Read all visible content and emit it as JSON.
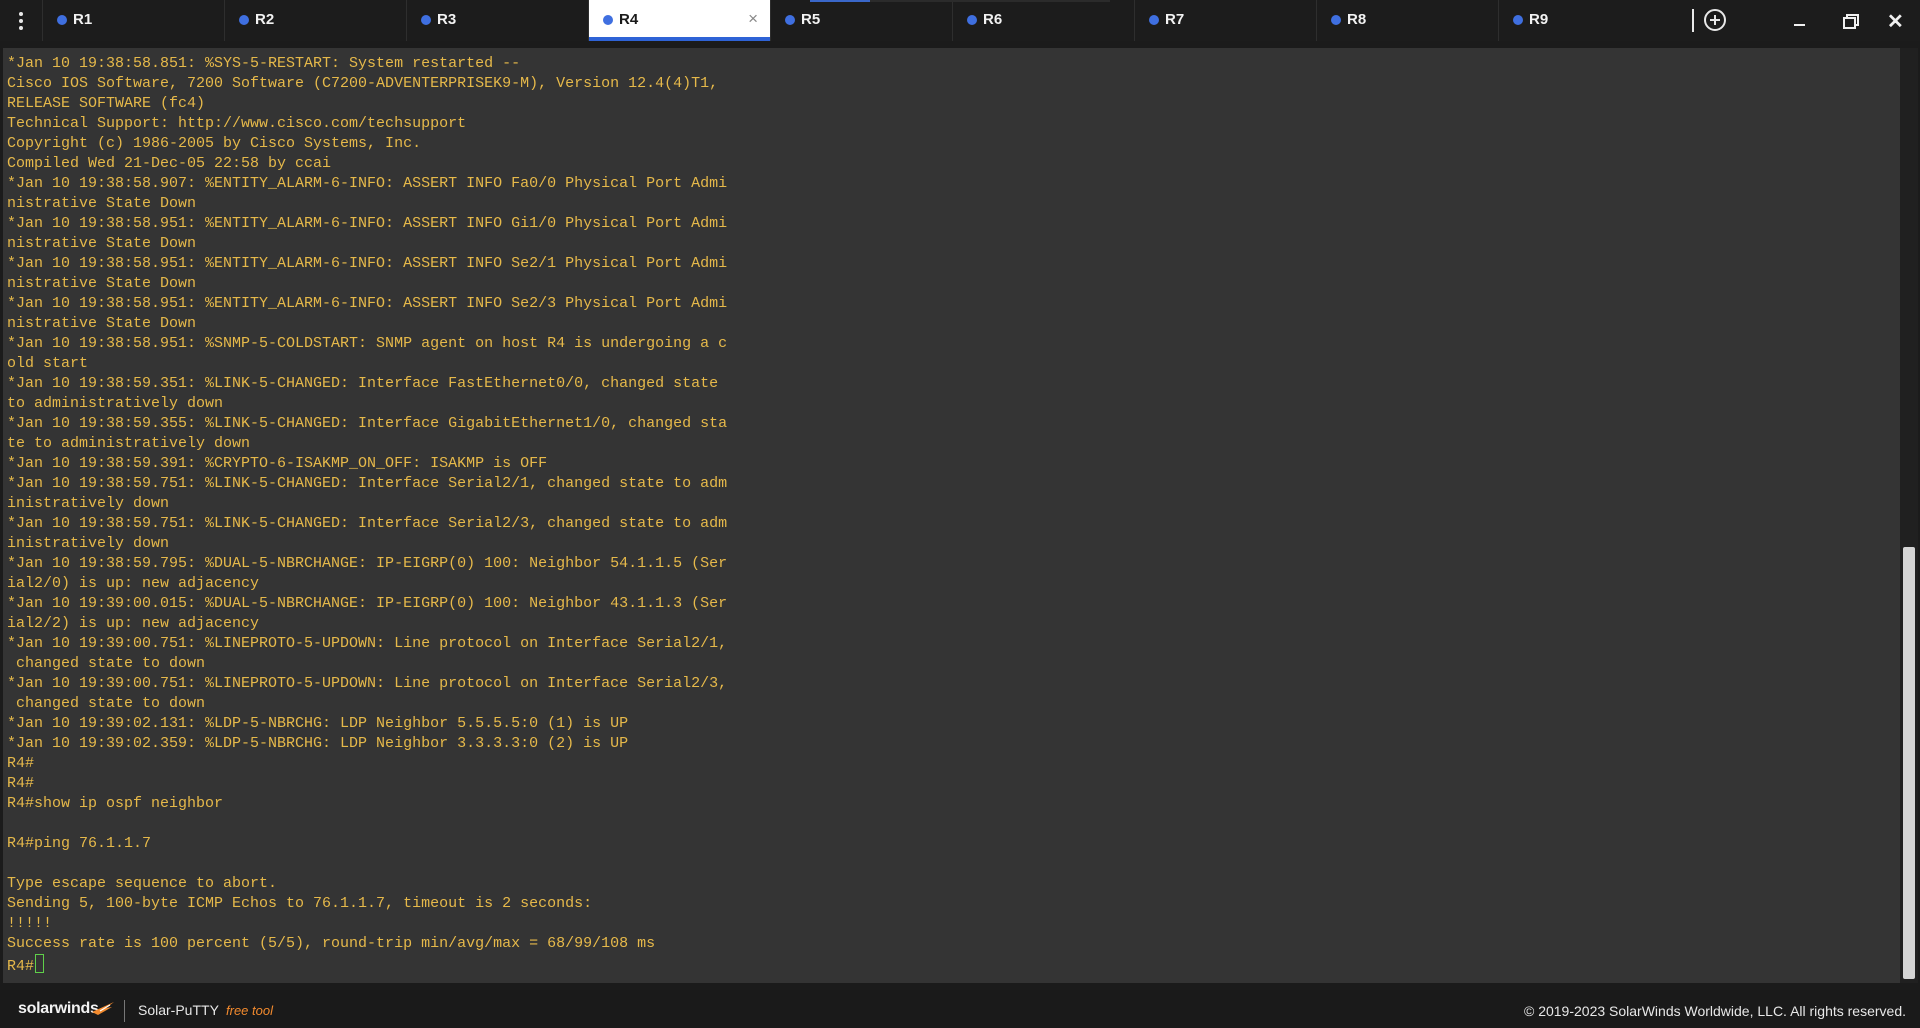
{
  "app": {
    "name": "Solar-PuTTY",
    "vendor": "solarwinds"
  },
  "tabs": [
    {
      "label": "R1",
      "active": false
    },
    {
      "label": "R2",
      "active": false
    },
    {
      "label": "R3",
      "active": false
    },
    {
      "label": "R4",
      "active": true
    },
    {
      "label": "R5",
      "active": false
    },
    {
      "label": "R6",
      "active": false
    },
    {
      "label": "R7",
      "active": false
    },
    {
      "label": "R8",
      "active": false
    },
    {
      "label": "R9",
      "active": false
    }
  ],
  "window_controls": {
    "add_tab": "add-tab",
    "minimize": "minimize",
    "restore": "restore",
    "close": "close"
  },
  "close_tab_glyph": "×",
  "colors": {
    "terminal_bg": "#343434",
    "terminal_text": "#e6b94a",
    "active_tab_accent": "#2f63d6",
    "tab_dot": "#3f6fe0",
    "cursor": "#5fd04a",
    "free_tool": "#f28a2e"
  },
  "terminal": {
    "lines": [
      "*Jan 10 19:38:58.851: %SYS-5-RESTART: System restarted --",
      "Cisco IOS Software, 7200 Software (C7200-ADVENTERPRISEK9-M), Version 12.4(4)T1,",
      "RELEASE SOFTWARE (fc4)",
      "Technical Support: http://www.cisco.com/techsupport",
      "Copyright (c) 1986-2005 by Cisco Systems, Inc.",
      "Compiled Wed 21-Dec-05 22:58 by ccai",
      "*Jan 10 19:38:58.907: %ENTITY_ALARM-6-INFO: ASSERT INFO Fa0/0 Physical Port Admi",
      "nistrative State Down",
      "*Jan 10 19:38:58.951: %ENTITY_ALARM-6-INFO: ASSERT INFO Gi1/0 Physical Port Admi",
      "nistrative State Down",
      "*Jan 10 19:38:58.951: %ENTITY_ALARM-6-INFO: ASSERT INFO Se2/1 Physical Port Admi",
      "nistrative State Down",
      "*Jan 10 19:38:58.951: %ENTITY_ALARM-6-INFO: ASSERT INFO Se2/3 Physical Port Admi",
      "nistrative State Down",
      "*Jan 10 19:38:58.951: %SNMP-5-COLDSTART: SNMP agent on host R4 is undergoing a c",
      "old start",
      "*Jan 10 19:38:59.351: %LINK-5-CHANGED: Interface FastEthernet0/0, changed state",
      "to administratively down",
      "*Jan 10 19:38:59.355: %LINK-5-CHANGED: Interface GigabitEthernet1/0, changed sta",
      "te to administratively down",
      "*Jan 10 19:38:59.391: %CRYPTO-6-ISAKMP_ON_OFF: ISAKMP is OFF",
      "*Jan 10 19:38:59.751: %LINK-5-CHANGED: Interface Serial2/1, changed state to adm",
      "inistratively down",
      "*Jan 10 19:38:59.751: %LINK-5-CHANGED: Interface Serial2/3, changed state to adm",
      "inistratively down",
      "*Jan 10 19:38:59.795: %DUAL-5-NBRCHANGE: IP-EIGRP(0) 100: Neighbor 54.1.1.5 (Ser",
      "ial2/0) is up: new adjacency",
      "*Jan 10 19:39:00.015: %DUAL-5-NBRCHANGE: IP-EIGRP(0) 100: Neighbor 43.1.1.3 (Ser",
      "ial2/2) is up: new adjacency",
      "*Jan 10 19:39:00.751: %LINEPROTO-5-UPDOWN: Line protocol on Interface Serial2/1,",
      " changed state to down",
      "*Jan 10 19:39:00.751: %LINEPROTO-5-UPDOWN: Line protocol on Interface Serial2/3,",
      " changed state to down",
      "*Jan 10 19:39:02.131: %LDP-5-NBRCHG: LDP Neighbor 5.5.5.5:0 (1) is UP",
      "*Jan 10 19:39:02.359: %LDP-5-NBRCHG: LDP Neighbor 3.3.3.3:0 (2) is UP",
      "R4#",
      "R4#",
      "R4#show ip ospf neighbor",
      "",
      "R4#ping 76.1.1.7",
      "",
      "Type escape sequence to abort.",
      "Sending 5, 100-byte ICMP Echos to 76.1.1.7, timeout is 2 seconds:",
      "!!!!!",
      "Success rate is 100 percent (5/5), round-trip min/avg/max = 68/99/108 ms"
    ],
    "prompt": "R4#"
  },
  "footer": {
    "logo": "solarwinds",
    "product": "Solar-PuTTY",
    "free_tool": "free tool",
    "copyright": "© 2019-2023 SolarWinds Worldwide, LLC. All rights reserved."
  }
}
